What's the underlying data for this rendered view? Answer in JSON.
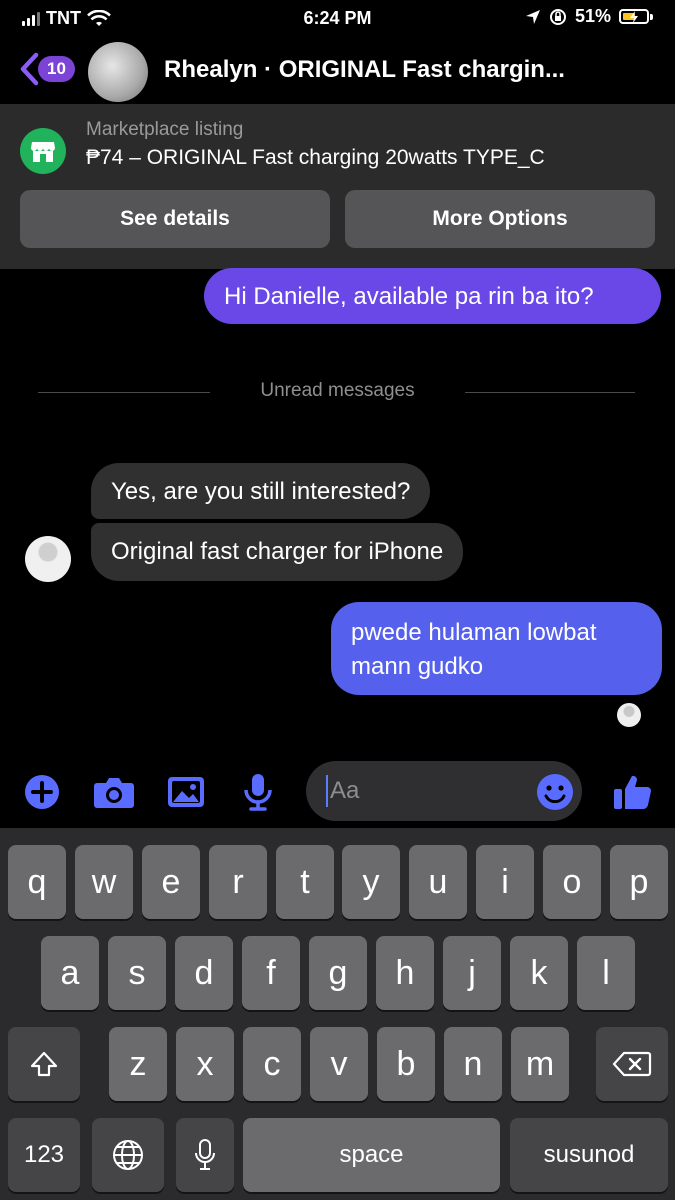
{
  "status_bar": {
    "carrier": "TNT",
    "time": "6:24 PM",
    "battery": "51%",
    "battery_level": 0.51,
    "battery_color": "#f4c324"
  },
  "header": {
    "back_badge": "10",
    "title": "Rhealyn · ORIGINAL Fast chargin..."
  },
  "listing": {
    "label": "Marketplace listing",
    "summary": "₱74 – ORIGINAL Fast charging 20watts TYPE_C",
    "buttons": {
      "see_details": "See details",
      "more_options": "More Options"
    }
  },
  "messages": [
    {
      "from": "me",
      "text": "Hi Danielle, available pa rin ba ito?"
    },
    {
      "from": "them",
      "text": "Yes, are you still interested?"
    },
    {
      "from": "them",
      "text": "Original fast charger for iPhone"
    },
    {
      "from": "me",
      "text": "pwede hulaman lowbat mann gudko"
    }
  ],
  "unread_label": "Unread messages",
  "composer": {
    "placeholder": "Aa",
    "icons": [
      "plus-icon",
      "camera-icon",
      "gallery-icon",
      "microphone-icon",
      "emoji-icon",
      "like-icon"
    ]
  },
  "keyboard": {
    "row1": [
      "q",
      "w",
      "e",
      "r",
      "t",
      "y",
      "u",
      "i",
      "o",
      "p"
    ],
    "row2": [
      "a",
      "s",
      "d",
      "f",
      "g",
      "h",
      "j",
      "k",
      "l"
    ],
    "row3": [
      "z",
      "x",
      "c",
      "v",
      "b",
      "n",
      "m"
    ],
    "numbers_key": "123",
    "space_key": "space",
    "return_key": "susunod"
  },
  "colors": {
    "outgoing_bubble_1": "#6a48e8",
    "outgoing_bubble_2": "#5561ec",
    "incoming_bubble": "#303030",
    "accent": "#5a6cff",
    "marketplace_icon": "#21b25c"
  }
}
